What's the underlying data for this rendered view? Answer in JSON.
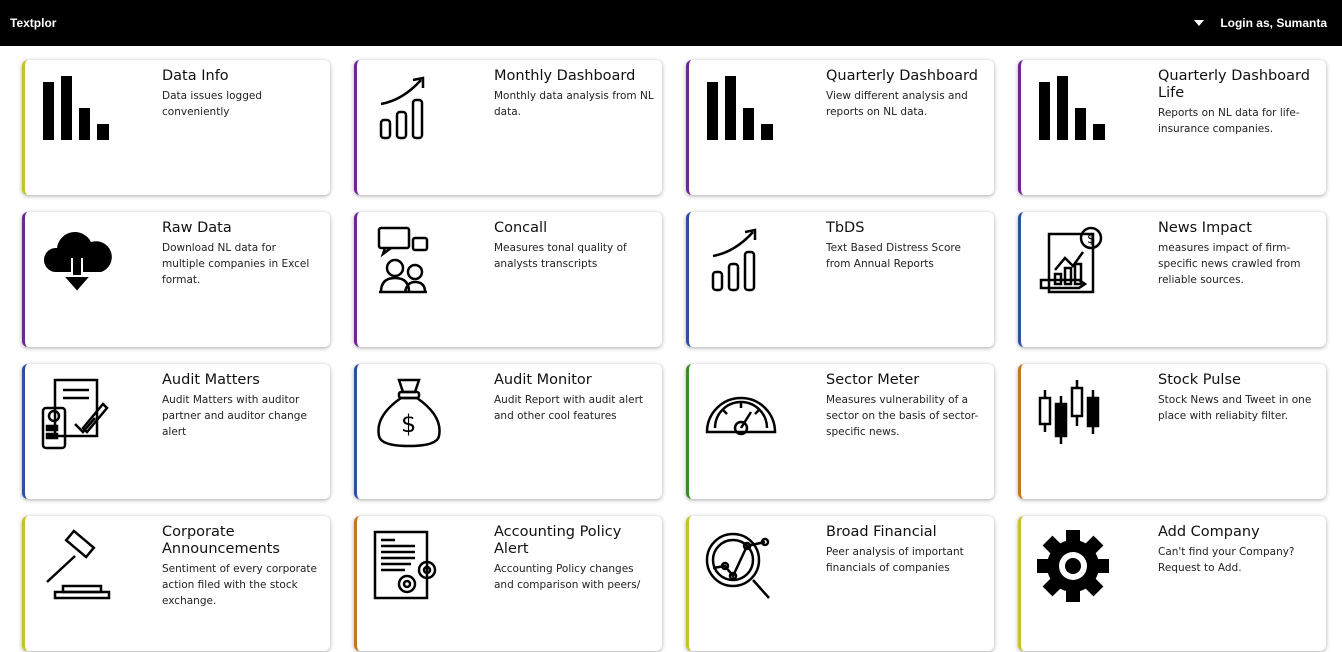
{
  "topbar": {
    "brand": "Textplor",
    "user_label": "Login as, Sumanta",
    "dropdown_icon": "caret-down-icon"
  },
  "cards": [
    {
      "title": "Data Info",
      "desc": "Data issues logged conveniently",
      "icon": "bar-chart-icon",
      "accent": "#c5c22a"
    },
    {
      "title": "Monthly Dashboard",
      "desc": "Monthly data analysis from NL data.",
      "icon": "growth-chart-icon",
      "accent": "#6b2a8f"
    },
    {
      "title": "Quarterly Dashboard",
      "desc": "View different analysis and reports on NL data.",
      "icon": "bar-chart-icon",
      "accent": "#6b2a8f"
    },
    {
      "title": "Quarterly Dashboard Life",
      "desc": "Reports on NL data for life-insurance companies.",
      "icon": "bar-chart-icon",
      "accent": "#6b2a8f"
    },
    {
      "title": "Raw Data",
      "desc": "Download NL data for multiple companies in Excel format.",
      "icon": "cloud-download-icon",
      "accent": "#6b2a8f"
    },
    {
      "title": "Concall",
      "desc": "Measures tonal quality of analysts transcripts",
      "icon": "conversation-icon",
      "accent": "#6b2a8f"
    },
    {
      "title": "TbDS",
      "desc": "Text Based Distress Score from Annual Reports",
      "icon": "growth-chart-icon",
      "accent": "#2f4fa0"
    },
    {
      "title": "News Impact",
      "desc": "measures impact of firm-specific news crawled from reliable sources.",
      "icon": "financial-report-icon",
      "accent": "#2f4fa0"
    },
    {
      "title": "Audit Matters",
      "desc": "Audit Matters with auditor partner and auditor change alert",
      "icon": "audit-document-icon",
      "accent": "#2f4fa0"
    },
    {
      "title": "Audit Monitor",
      "desc": "Audit Report with audit alert and other cool features",
      "icon": "money-bag-icon",
      "accent": "#2f4fa0"
    },
    {
      "title": "Sector Meter",
      "desc": "Measures vulnerability of a sector on the basis of sector-specific news.",
      "icon": "gauge-icon",
      "accent": "#3a8a2a"
    },
    {
      "title": "Stock Pulse",
      "desc": "Stock News and Tweet in one place with reliabity filter.",
      "icon": "candlestick-icon",
      "accent": "#c07a1a"
    },
    {
      "title": "Corporate Announcements",
      "desc": "Sentiment of every corporate action filed with the stock exchange.",
      "icon": "gavel-icon",
      "accent": "#c5c22a"
    },
    {
      "title": "Accounting Policy Alert",
      "desc": "Accounting Policy changes and comparison with peers/",
      "icon": "policy-document-icon",
      "accent": "#c07a1a"
    },
    {
      "title": "Broad Financial",
      "desc": "Peer analysis of important financials of companies",
      "icon": "magnifier-chart-icon",
      "accent": "#c5c22a"
    },
    {
      "title": "Add Company",
      "desc": "Can't find your Company? Request to Add.",
      "icon": "gear-icon",
      "accent": "#c5c22a"
    }
  ]
}
